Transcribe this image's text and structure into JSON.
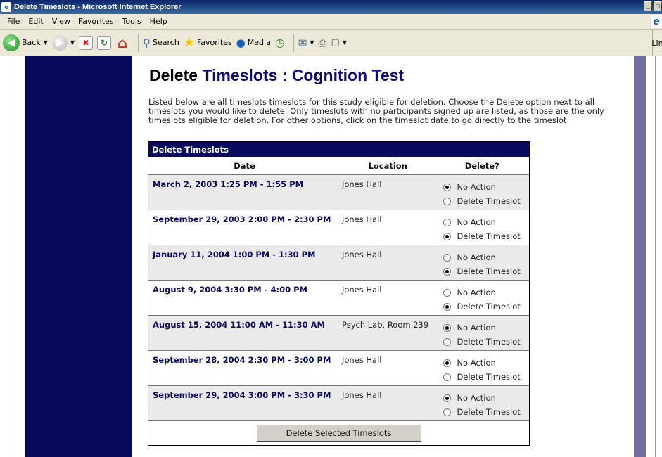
{
  "window": {
    "title": "Delete Timeslots - Microsoft Internet Explorer",
    "controls": [
      "_",
      "□"
    ]
  },
  "menubar": {
    "items": [
      "File",
      "Edit",
      "View",
      "Favorites",
      "Tools",
      "Help"
    ]
  },
  "toolbar": {
    "back_label": "Back",
    "search_label": "Search",
    "favorites_label": "Favorites",
    "media_label": "Media",
    "links_label": "Lin"
  },
  "page": {
    "title_prefix": "Delete",
    "title_accent": "Timeslots : Cognition Test",
    "intro": "Listed below are all timeslots timeslots for this study eligible for deletion. Choose the Delete option next to all timeslots you would like to delete. Only timeslots with no participants signed up are listed, as those are the only timeslots eligible for deletion. For other options, click on the timeslot date to go directly to the timeslot."
  },
  "table": {
    "heading": "Delete Timeslots",
    "columns": [
      "Date",
      "Location",
      "Delete?"
    ],
    "option_labels": [
      "No Action",
      "Delete Timeslot"
    ],
    "rows": [
      {
        "date": "March 2, 2003 1:25 PM - 1:55 PM",
        "location": "Jones Hall",
        "selected": "No Action"
      },
      {
        "date": "September 29, 2003 2:00 PM - 2:30 PM",
        "location": "Jones Hall",
        "selected": "Delete Timeslot"
      },
      {
        "date": "January 11, 2004 1:00 PM - 1:30 PM",
        "location": "Jones Hall",
        "selected": "Delete Timeslot"
      },
      {
        "date": "August 9, 2004 3:30 PM - 4:00 PM",
        "location": "Jones Hall",
        "selected": "Delete Timeslot"
      },
      {
        "date": "August 15, 2004 11:00 AM - 11:30 AM",
        "location": "Psych Lab, Room 239",
        "selected": "No Action"
      },
      {
        "date": "September 28, 2004 2:30 PM - 3:00 PM",
        "location": "Jones Hall",
        "selected": "No Action"
      },
      {
        "date": "September 29, 2004 3:00 PM - 3:30 PM",
        "location": "Jones Hall",
        "selected": "No Action"
      }
    ],
    "submit_label": "Delete Selected Timeslots"
  },
  "colors": {
    "nav_bar": "#0a0a5c",
    "accent_text": "#0a0a7a",
    "right_bar": "#6e6e9f"
  }
}
